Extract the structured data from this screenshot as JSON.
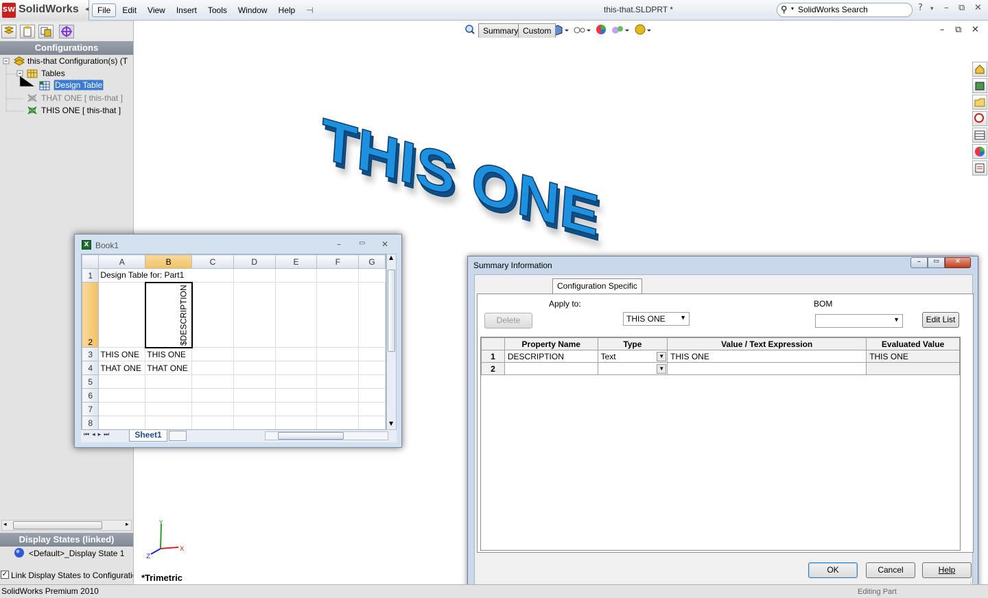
{
  "app": {
    "name": "SolidWorks",
    "logo_text": "SW",
    "document_title": "this-that.SLDPRT *"
  },
  "menu": [
    "File",
    "Edit",
    "View",
    "Insert",
    "Tools",
    "Window",
    "Help"
  ],
  "search": {
    "placeholder": "SolidWorks Search"
  },
  "left_panel": {
    "configurations_header": "Configurations",
    "tree": {
      "root": "this-that Configuration(s)  (T",
      "tables": "Tables",
      "design_table": "Design Table",
      "config_inactive": "THAT ONE [ this-that ]",
      "config_active": "THIS ONE [ this-that ]"
    },
    "display_states_header": "Display States (linked)",
    "display_state": "<Default>_Display State 1",
    "link_checkbox_label": "Link Display States to Configuratio",
    "link_checked": true
  },
  "viewport": {
    "model_text": "THIS ONE",
    "model_color": "#1e90e0",
    "view_label": "*Trimetric",
    "axes": {
      "x": "X",
      "y": "Y",
      "z": "Z"
    }
  },
  "excel": {
    "title": "Book1",
    "columns": [
      "A",
      "B",
      "C",
      "D",
      "E",
      "F",
      "G"
    ],
    "rows": [
      "1",
      "2",
      "3",
      "4",
      "5",
      "6",
      "7",
      "8"
    ],
    "cells": {
      "A1": "Design Table for: Part1",
      "B2": "$DESCRIPTION",
      "A3": "THIS ONE",
      "B3": "THIS ONE",
      "A4": "THAT ONE",
      "B4": "THAT ONE"
    },
    "sheet_tab": "Sheet1"
  },
  "dialog": {
    "title": "Summary Information",
    "tabs": [
      "Summary",
      "Custom",
      "Configuration Specific"
    ],
    "apply_to_label": "Apply to:",
    "apply_to_value": "THIS ONE",
    "bom_label": "BOM",
    "bom_value": "",
    "delete_button": "Delete",
    "edit_list_button": "Edit List",
    "table": {
      "headers": [
        "Property Name",
        "Type",
        "Value / Text Expression",
        "Evaluated Value"
      ],
      "rows": [
        {
          "num": "1",
          "property": "DESCRIPTION",
          "type": "Text",
          "value": "THIS ONE",
          "evaluated": "THIS ONE"
        },
        {
          "num": "2",
          "property": "",
          "type": "",
          "value": "",
          "evaluated": ""
        }
      ]
    },
    "ok_button": "OK",
    "cancel_button": "Cancel",
    "help_button": "Help"
  },
  "status_bar": {
    "text": "SolidWorks Premium 2010",
    "right_text": "Editing Part"
  }
}
